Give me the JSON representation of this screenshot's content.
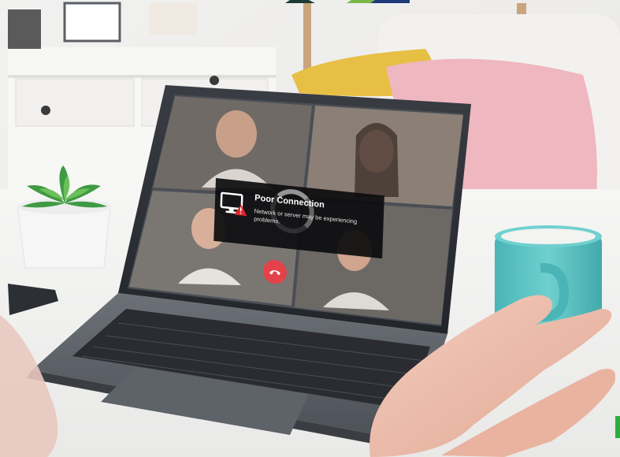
{
  "dialog": {
    "title": "Poor Connection",
    "message": "Network or server may be experiencing problems."
  },
  "icons": {
    "monitor": "monitor-warning-icon",
    "end_call": "phone-hangup-icon"
  },
  "colors": {
    "mug": "#5ec4c4",
    "pillow_pink": "#efb7c0",
    "pillow_yellow": "#e8bf45",
    "end_call": "#e5414b",
    "warning": "#e0262e"
  }
}
